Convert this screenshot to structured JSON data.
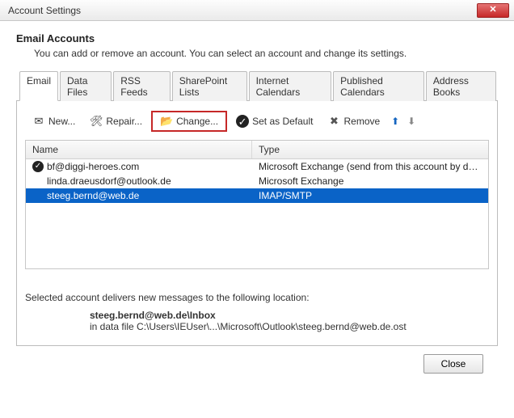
{
  "window": {
    "title": "Account Settings"
  },
  "header": {
    "title": "Email Accounts",
    "description": "You can add or remove an account. You can select an account and change its settings."
  },
  "tabs": [
    {
      "label": "Email",
      "active": true
    },
    {
      "label": "Data Files",
      "active": false
    },
    {
      "label": "RSS Feeds",
      "active": false
    },
    {
      "label": "SharePoint Lists",
      "active": false
    },
    {
      "label": "Internet Calendars",
      "active": false
    },
    {
      "label": "Published Calendars",
      "active": false
    },
    {
      "label": "Address Books",
      "active": false
    }
  ],
  "toolbar": {
    "new_label": "New...",
    "repair_label": "Repair...",
    "change_label": "Change...",
    "set_default_label": "Set as Default",
    "remove_label": "Remove"
  },
  "columns": {
    "name": "Name",
    "type": "Type"
  },
  "accounts": [
    {
      "name": "bf@diggi-heroes.com",
      "type": "Microsoft Exchange (send from this account by def...",
      "default": true,
      "selected": false
    },
    {
      "name": "linda.draeusdorf@outlook.de",
      "type": "Microsoft Exchange",
      "default": false,
      "selected": false
    },
    {
      "name": "steeg.bernd@web.de",
      "type": "IMAP/SMTP",
      "default": false,
      "selected": true
    }
  ],
  "footer": {
    "intro": "Selected account delivers new messages to the following location:",
    "target": "steeg.bernd@web.de\\Inbox",
    "datafile_prefix": "in data file ",
    "datafile_path": "C:\\Users\\IEUser\\...\\Microsoft\\Outlook\\steeg.bernd@web.de.ost"
  },
  "buttons": {
    "close": "Close"
  }
}
